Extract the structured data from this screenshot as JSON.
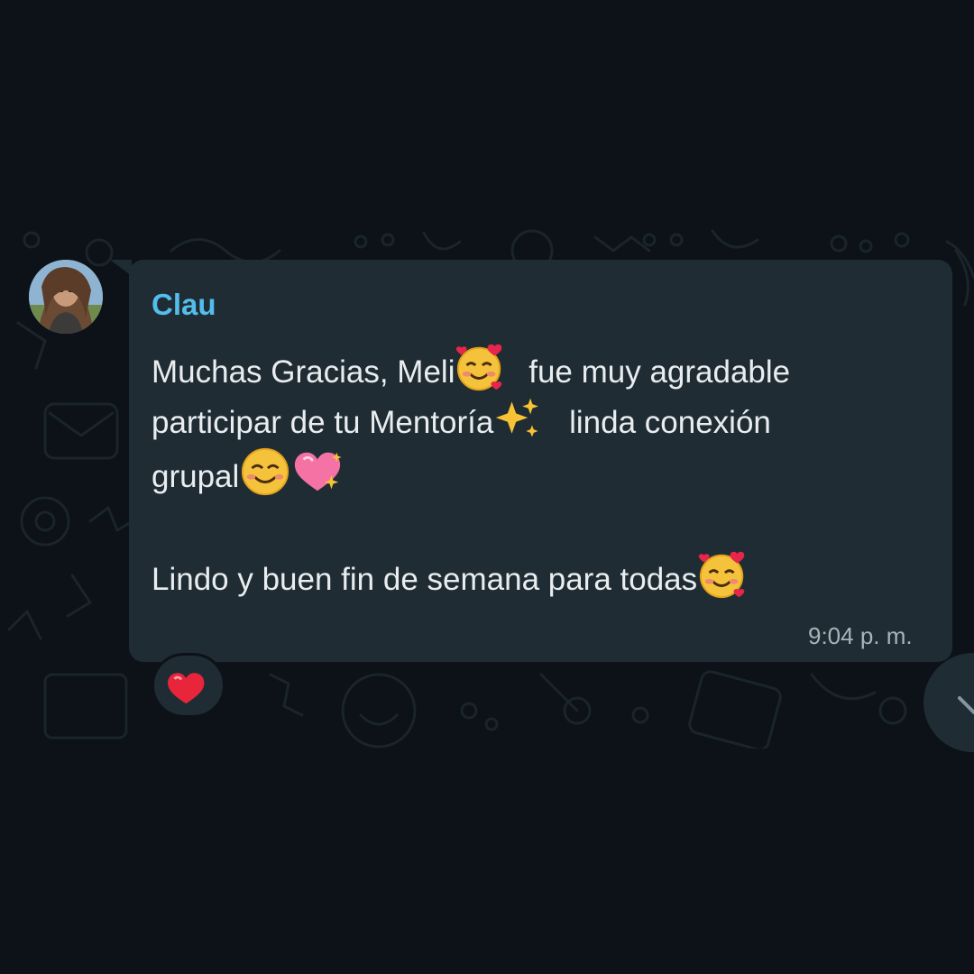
{
  "chat": {
    "message": {
      "sender": "Clau",
      "lines": [
        "Muchas Gracias, Meli",
        "fue muy agradable",
        "participar de tu Mentoría",
        "linda conexión",
        "grupal",
        "Lindo y buen fin de semana para todas"
      ],
      "time": "9:04 p. m."
    },
    "reaction": "heart-emoji",
    "emojis": [
      "smiling-face-with-hearts-emoji",
      "sparkles-emoji",
      "smiling-face-emoji",
      "sparkling-heart-emoji"
    ],
    "colors": {
      "background": "#0c1217",
      "bubble": "#1f2c34",
      "sender": "#53bdeb",
      "text": "#e9edef",
      "meta": "#a9b3b8"
    }
  }
}
